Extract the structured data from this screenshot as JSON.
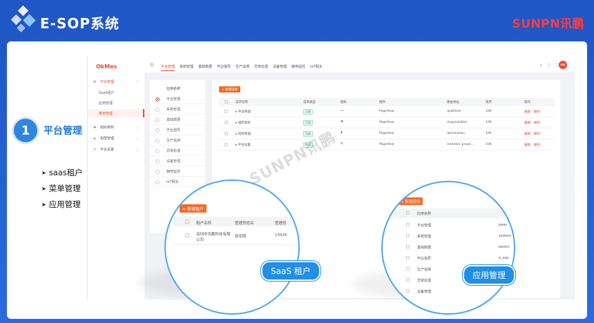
{
  "brand": {
    "title": "E-SOP系统",
    "logo_right": "SUNPN讯鹏"
  },
  "step": {
    "number": "1",
    "title": "平台管理"
  },
  "bullets": [
    "saas租户",
    "菜单管理",
    "应用管理"
  ],
  "app": {
    "logo": "OkMes",
    "sidebar": {
      "groups": [
        {
          "label": "平台管理",
          "icon": "gear-icon",
          "active": true
        },
        {
          "label": "组织架构",
          "icon": "org-icon"
        },
        {
          "label": "权限管理",
          "icon": "shield-icon"
        },
        {
          "label": "平台设置",
          "icon": "sliders-icon"
        }
      ],
      "subitems": [
        "SaaS租户",
        "应用管理",
        "菜单管理"
      ]
    },
    "tabs": [
      "平台管理",
      "系统管理",
      "基础数据",
      "作业指导",
      "生产追溯",
      "异常处理",
      "设备管理",
      "静电监控",
      "IoT网关"
    ],
    "avatar_text": "随峰",
    "app_list": {
      "header": "应用名称",
      "items": [
        "平台管理",
        "系统管理",
        "基础数据",
        "作业指导",
        "生产追溯",
        "异常处理",
        "设备管理",
        "静电监控",
        "IoT网关"
      ]
    },
    "menu_table": {
      "add_label": "+ 新增菜单",
      "columns": [
        "菜单名称",
        "菜单类型",
        "图标",
        "组件",
        "路由地址",
        "排序",
        "操作"
      ],
      "rows": [
        {
          "name": "平台管理",
          "type": "目录",
          "component": "PageView",
          "path": "/platform",
          "order": "100"
        },
        {
          "name": "组织架构",
          "type": "目录",
          "component": "PageView",
          "path": "/organization",
          "order": "100"
        },
        {
          "name": "权限管理",
          "type": "目录",
          "component": "PageView",
          "path": "/permission",
          "order": "100"
        },
        {
          "name": "平台设置",
          "type": "目录",
          "component": "PageView",
          "path": "/solution_prope...",
          "order": "100"
        }
      ],
      "op_edit": "编辑",
      "op_delete": "删除"
    }
  },
  "zoom_saas": {
    "add_label": "+ 新增租户",
    "columns": [
      "租户名称",
      "管理员姓名",
      "管理员"
    ],
    "row": {
      "name": "深圳市讯鹏科技有限公司",
      "admin": "郭亚刚",
      "phone": "13926"
    },
    "pill": "SaaS 租户"
  },
  "zoom_app": {
    "add_label": "+ 新增应用",
    "columns": [
      "应用名称"
    ],
    "rows": [
      "平台管理",
      "系统管理",
      "基础数据",
      "作业指导",
      "生产追溯",
      "异常处理",
      "设备管理"
    ],
    "right_vals": [
      "paas",
      "system",
      "basics",
      "e_sop"
    ],
    "pill": "应用管理"
  },
  "watermark": "SUNPN讯鹏"
}
